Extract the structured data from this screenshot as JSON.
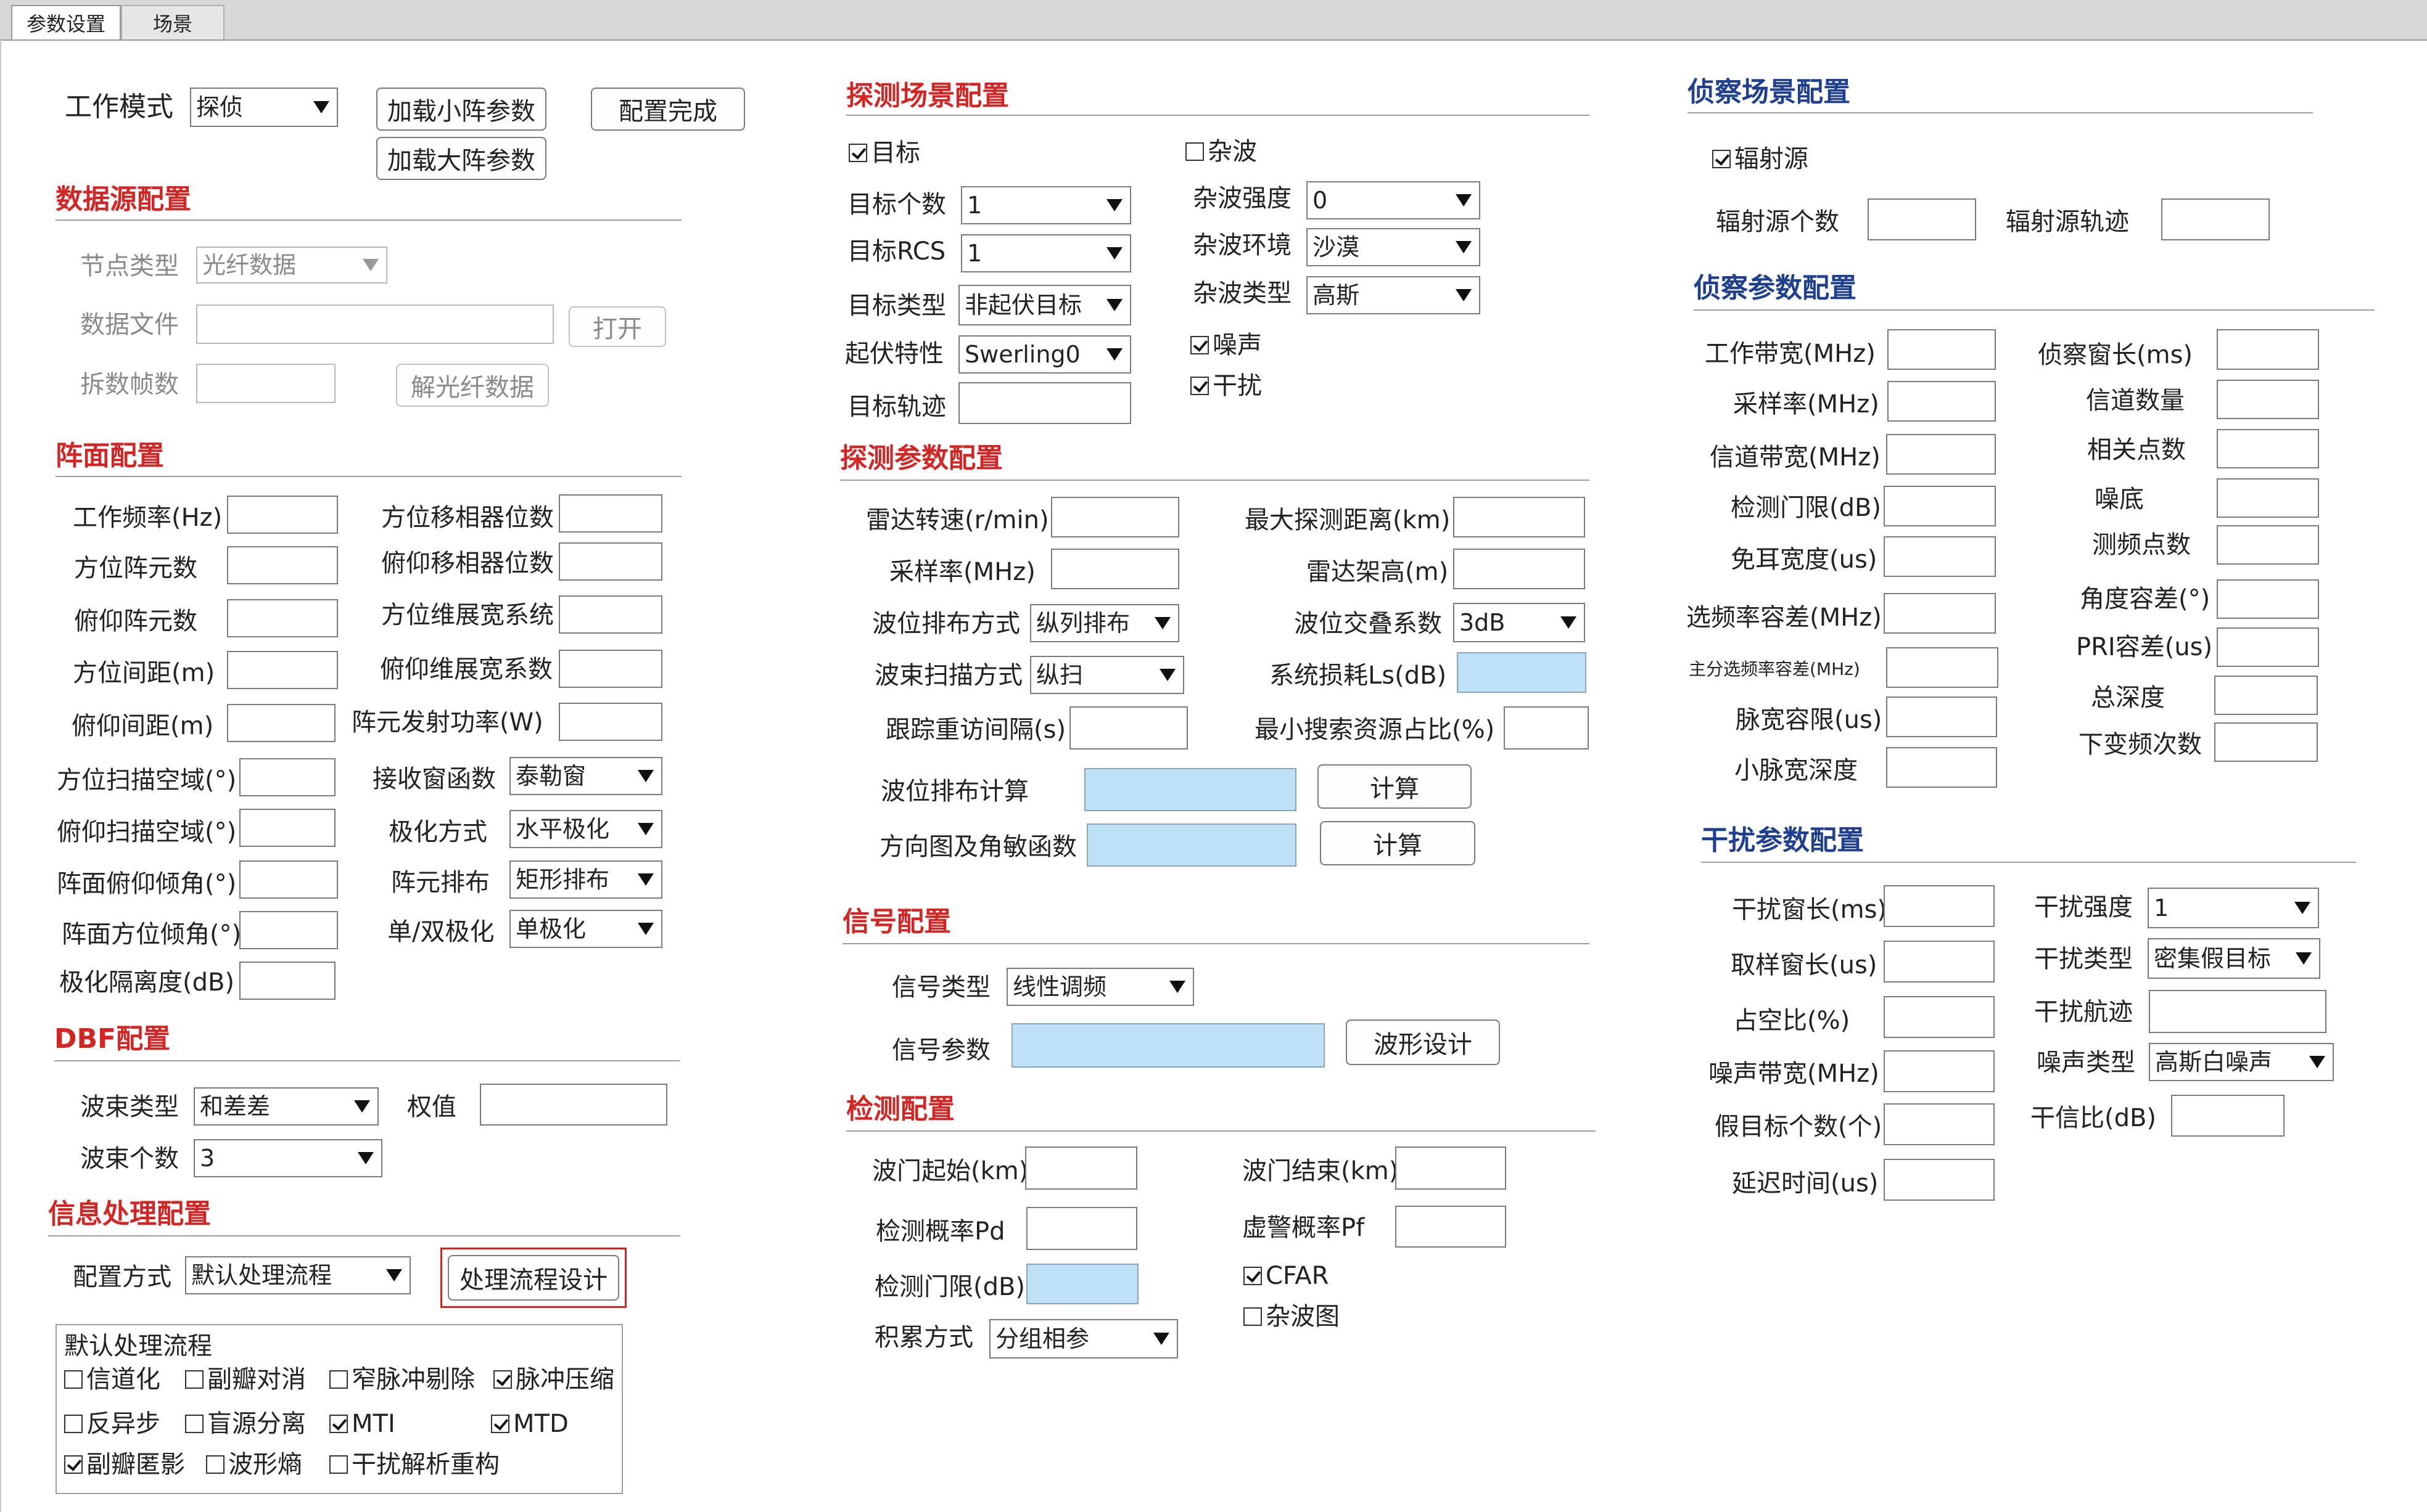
{
  "tabs": [
    "参数设置",
    "场景"
  ],
  "top": {
    "work_mode_label": "工作模式",
    "work_mode_value": "探侦",
    "load_small_array": "加载小阵参数",
    "load_large_array": "加载大阵参数",
    "config_done": "配置完成"
  },
  "datasource": {
    "title": "数据源配置",
    "node_type_label": "节点类型",
    "node_type_value": "光纤数据",
    "data_file_label": "数据文件",
    "open_button": "打开",
    "split_frames_label": "拆数帧数",
    "decode_button": "解光纤数据"
  },
  "array": {
    "title": "阵面配置",
    "work_freq": "工作频率(Hz)",
    "az_elements": "方位阵元数",
    "el_elements": "俯仰阵元数",
    "az_spacing": "方位间距(m)",
    "el_spacing": "俯仰间距(m)",
    "az_scan": "方位扫描空域(°)",
    "el_scan": "俯仰扫描空域(°)",
    "face_el_tilt": "阵面俯仰倾角(°)",
    "face_az_tilt": "阵面方位倾角(°)",
    "pol_isolation": "极化隔离度(dB)",
    "az_phase_bits": "方位移相器位数",
    "el_phase_bits": "俯仰移相器位数",
    "az_broadening": "方位维展宽系统",
    "el_broadening": "俯仰维展宽系数",
    "elem_power": "阵元发射功率(W)",
    "rx_window": "接收窗函数",
    "rx_window_value": "泰勒窗",
    "polarization": "极化方式",
    "polarization_value": "水平极化",
    "elem_layout": "阵元排布",
    "elem_layout_value": "矩形排布",
    "single_dual": "单/双极化",
    "single_dual_value": "单极化"
  },
  "dbf": {
    "title": "DBF配置",
    "beam_type": "波束类型",
    "beam_type_value": "和差差",
    "weight": "权值",
    "beam_count": "波束个数",
    "beam_count_value": "3"
  },
  "info": {
    "title": "信息处理配置",
    "config_mode": "配置方式",
    "config_mode_value": "默认处理流程",
    "flow_design": "处理流程设计",
    "group_title": "默认处理流程",
    "checks": [
      {
        "label": "信道化",
        "checked": false
      },
      {
        "label": "副瓣对消",
        "checked": false
      },
      {
        "label": "窄脉冲剔除",
        "checked": false
      },
      {
        "label": "脉冲压缩",
        "checked": true
      },
      {
        "label": "反异步",
        "checked": false
      },
      {
        "label": "盲源分离",
        "checked": false
      },
      {
        "label": "MTI",
        "checked": true
      },
      {
        "label": "MTD",
        "checked": true
      },
      {
        "label": "副瓣匿影",
        "checked": true
      },
      {
        "label": "波形熵",
        "checked": false
      },
      {
        "label": "干扰解析重构",
        "checked": false
      }
    ]
  },
  "scene": {
    "title": "探测场景配置",
    "target": "目标",
    "target_checked": true,
    "clutter": "杂波",
    "clutter_checked": false,
    "target_count": "目标个数",
    "target_count_value": "1",
    "target_rcs": "目标RCS",
    "target_rcs_value": "1",
    "target_type": "目标类型",
    "target_type_value": "非起伏目标",
    "fluct": "起伏特性",
    "fluct_value": "Swerling0",
    "track": "目标轨迹",
    "clutter_strength": "杂波强度",
    "clutter_strength_value": "0",
    "clutter_env": "杂波环境",
    "clutter_env_value": "沙漠",
    "clutter_type": "杂波类型",
    "clutter_type_value": "高斯",
    "noise": "噪声",
    "noise_checked": true,
    "jam": "干扰",
    "jam_checked": true
  },
  "detect": {
    "title": "探测参数配置",
    "rotate": "雷达转速(r/min)",
    "sample": "采样率(MHz)",
    "wave_arr": "波位排布方式",
    "wave_arr_value": "纵列排布",
    "beam_scan": "波束扫描方式",
    "beam_scan_value": "纵扫",
    "revisit": "跟踪重访间隔(s)",
    "max_range": "最大探测距离(km)",
    "height": "雷达架高(m)",
    "overlap": "波位交叠系数",
    "overlap_value": "3dB",
    "loss": "系统损耗Ls(dB)",
    "min_search": "最小搜索资源占比(%)",
    "wave_calc": "波位排布计算",
    "pattern": "方向图及角敏函数",
    "calc": "计算"
  },
  "signal": {
    "title": "信号配置",
    "type": "信号类型",
    "type_value": "线性调频",
    "param": "信号参数",
    "design": "波形设计"
  },
  "check": {
    "title": "检测配置",
    "gate_start": "波门起始(km)",
    "gate_end": "波门结束(km)",
    "pd": "检测概率Pd",
    "pf": "虚警概率Pf",
    "threshold": "检测门限(dB)",
    "cfar": "CFAR",
    "cfar_checked": true,
    "clutter_map": "杂波图",
    "clutter_map_checked": false,
    "integrate": "积累方式",
    "integrate_value": "分组相参"
  },
  "recon_scene": {
    "title": "侦察场景配置",
    "emitter": "辐射源",
    "emitter_checked": true,
    "emitter_count": "辐射源个数",
    "emitter_track": "辐射源轨迹"
  },
  "recon": {
    "title": "侦察参数配置",
    "bw": "工作带宽(MHz)",
    "sample": "采样率(MHz)",
    "ch_bw": "信道带宽(MHz)",
    "threshold": "检测门限(dB)",
    "blank": "免耳宽度(us)",
    "freq_tol": "选频率容差(MHz)",
    "main_tol": "主分选频率容差(MHz)",
    "pw_limit": "脉宽容限(us)",
    "small_pw": "小脉宽深度",
    "window": "侦察窗长(ms)",
    "channels": "信道数量",
    "corr": "相关点数",
    "floor": "噪底",
    "freq_pts": "测频点数",
    "angle_tol": "角度容差(°)",
    "pri_tol": "PRI容差(us)",
    "depth": "总深度",
    "downconv": "下变频次数"
  },
  "jam": {
    "title": "干扰参数配置",
    "window": "干扰窗长(ms)",
    "sample_win": "取样窗长(us)",
    "duty": "占空比(%)",
    "noise_bw": "噪声带宽(MHz)",
    "false_count": "假目标个数(个)",
    "delay": "延迟时间(us)",
    "strength": "干扰强度",
    "strength_value": "1",
    "type": "干扰类型",
    "type_value": "密集假目标",
    "track": "干扰航迹",
    "noise_type": "噪声类型",
    "noise_type_value": "高斯白噪声",
    "jsr": "干信比(dB)"
  }
}
